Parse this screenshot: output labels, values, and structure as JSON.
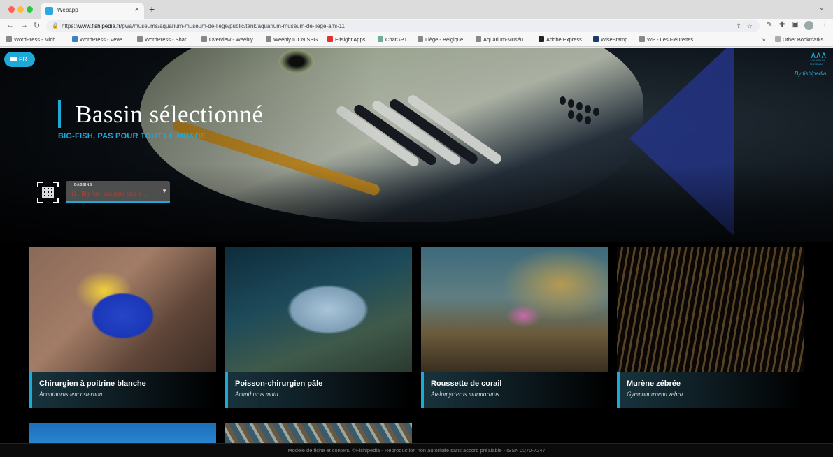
{
  "browser": {
    "tab_title": "Webapp",
    "url_prefix": "https://",
    "url_host": "www.fishipedia.fr",
    "url_path": "/pwa/museums/aquarium-museum-de-liege/public/tank/aquarium-museum-de-liege-ami-11",
    "bookmarks": [
      "WordPress - Mich...",
      "WordPress - Veve...",
      "WordPress - Shar...",
      "Overview - Weebly",
      "Weebly IUCN SSG",
      "Elfsight Apps",
      "ChatGPT",
      "Liège - Belgique",
      "Aquarium-Muséu...",
      "Adobe Express",
      "WiseStamp",
      "WP - Les Fleurettes"
    ],
    "other_bookmarks": "Other Bookmarks"
  },
  "hero": {
    "lang": "FR",
    "title": "Bassin sélectionné",
    "subtitle": "BIG-FISH, PAS POUR TOUT LE MONDE",
    "brand_by": "By fishipedia",
    "select_label": "BASSINS",
    "select_value": "11 - Big-fish, pas pour tout le ..."
  },
  "species": [
    {
      "name": "Chirurgien à poitrine blanche",
      "scientific": "Acanthurus leucosternon"
    },
    {
      "name": "Poisson-chirurgien pâle",
      "scientific": "Acanthurus mata"
    },
    {
      "name": "Roussette de corail",
      "scientific": "Atelomycterus marmoratus"
    },
    {
      "name": "Murène zébrée",
      "scientific": "Gymnomuraena zebra"
    }
  ],
  "footer": "Modèle de fiche et contenu ©Fishipedia - Reproduction non autorisée sans accord préalable - ISSN 2270-7247",
  "colors": {
    "accent": "#1fa9d6",
    "select_value": "#c0392b"
  }
}
